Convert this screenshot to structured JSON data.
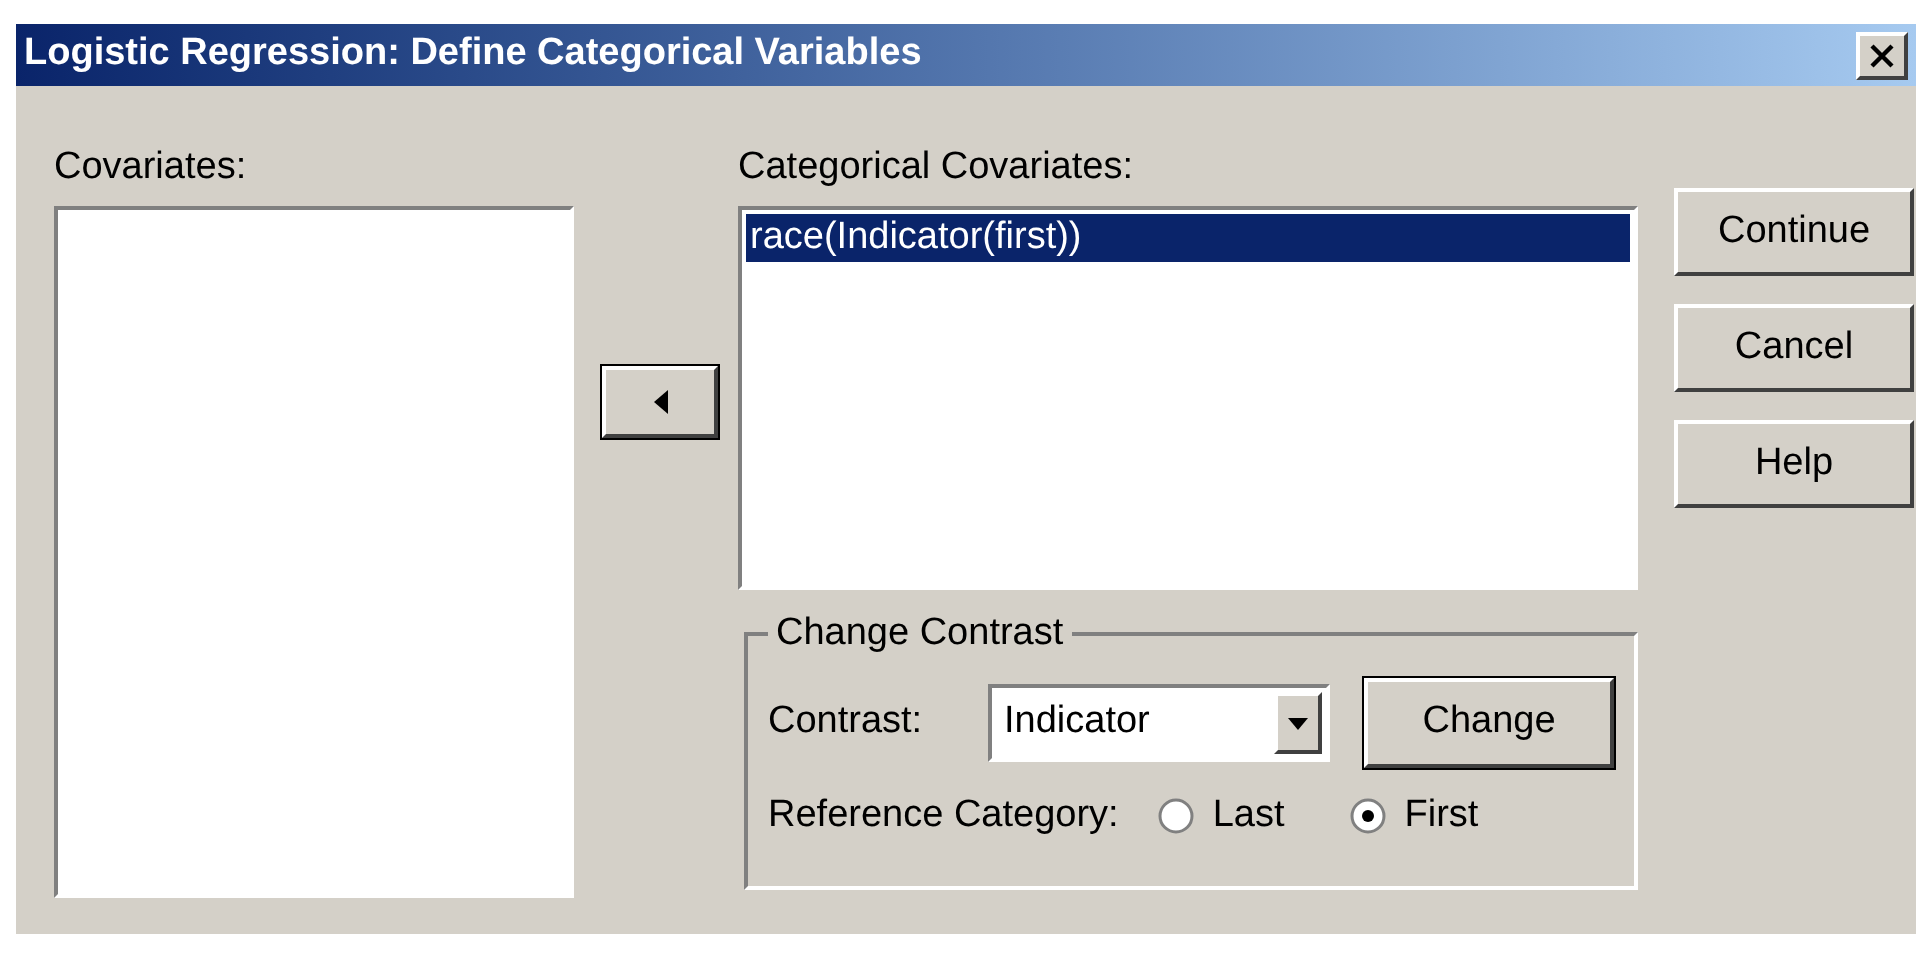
{
  "window": {
    "title": "Logistic Regression: Define Categorical Variables"
  },
  "covariates": {
    "label": "Covariates:"
  },
  "categorical_covariates": {
    "label": "Categorical Covariates:",
    "items": [
      {
        "text": "race(Indicator(first))",
        "selected": true
      }
    ]
  },
  "change_contrast": {
    "title": "Change Contrast",
    "contrast_label": "Contrast:",
    "contrast_value": "Indicator",
    "change_button": "Change",
    "reference_label": "Reference Category:",
    "reference_options": [
      {
        "label": "Last",
        "selected": false
      },
      {
        "label": "First",
        "selected": true
      }
    ]
  },
  "buttons": [
    "Continue",
    "Cancel",
    "Help"
  ]
}
